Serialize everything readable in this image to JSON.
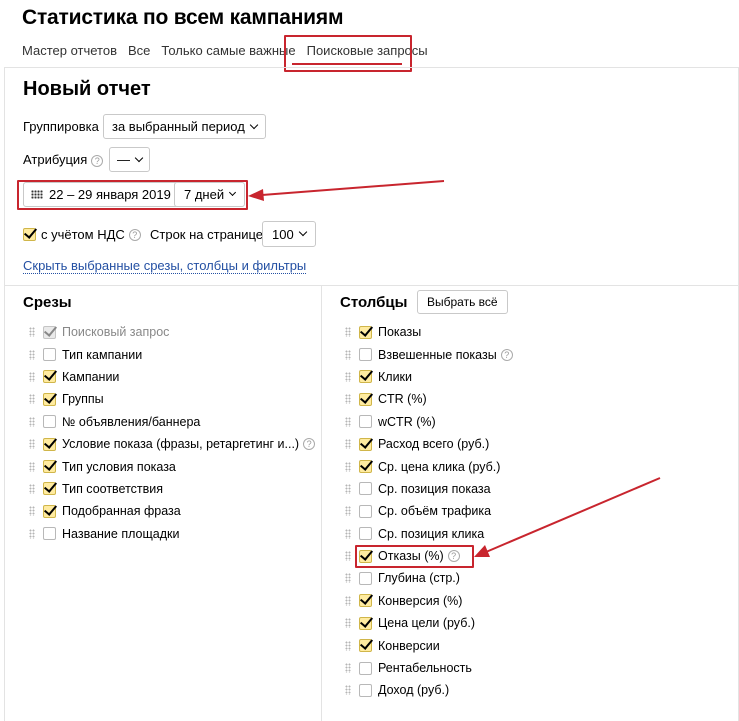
{
  "header": {
    "title": "Статистика по всем кампаниям"
  },
  "tabs": [
    {
      "label": "Мастер отчетов"
    },
    {
      "label": "Все"
    },
    {
      "label": "Только самые важные"
    },
    {
      "label": "Поисковые запросы"
    }
  ],
  "report": {
    "title": "Новый отчет",
    "grouping_label": "Группировка",
    "grouping_value": "за выбранный период",
    "attribution_label": "Атрибуция",
    "attribution_value": "—",
    "date_range": "22 – 29 января 2019",
    "period": "7 дней",
    "vat_label": "с учётом НДС",
    "rows_label": "Строк на странице",
    "rows_value": "100",
    "hide_link": "Скрыть выбранные срезы, столбцы и фильтры"
  },
  "slices": {
    "title": "Срезы",
    "items": [
      {
        "label": "Поисковый запрос",
        "checked": true,
        "disabled": true
      },
      {
        "label": "Тип кампании",
        "checked": false
      },
      {
        "label": "Кампании",
        "checked": true
      },
      {
        "label": "Группы",
        "checked": true
      },
      {
        "label": "№ объявления/баннера",
        "checked": false
      },
      {
        "label": "Условие показа (фразы, ретаргетинг и...)",
        "checked": true,
        "help": true
      },
      {
        "label": "Тип условия показа",
        "checked": true
      },
      {
        "label": "Тип соответствия",
        "checked": true
      },
      {
        "label": "Подобранная фраза",
        "checked": true
      },
      {
        "label": "Название площадки",
        "checked": false
      }
    ]
  },
  "columns": {
    "title": "Столбцы",
    "select_all": "Выбрать всё",
    "items": [
      {
        "label": "Показы",
        "checked": true
      },
      {
        "label": "Взвешенные показы",
        "checked": false,
        "help": true
      },
      {
        "label": "Клики",
        "checked": true
      },
      {
        "label": "CTR (%)",
        "checked": true
      },
      {
        "label": "wCTR (%)",
        "checked": false
      },
      {
        "label": "Расход всего (руб.)",
        "checked": true
      },
      {
        "label": "Ср. цена клика (руб.)",
        "checked": true
      },
      {
        "label": "Ср. позиция показа",
        "checked": false
      },
      {
        "label": "Ср. объём трафика",
        "checked": false
      },
      {
        "label": "Ср. позиция клика",
        "checked": false
      },
      {
        "label": "Отказы (%)",
        "checked": true,
        "help": true
      },
      {
        "label": "Глубина (стр.)",
        "checked": false
      },
      {
        "label": "Конверсия (%)",
        "checked": true
      },
      {
        "label": "Цена цели (руб.)",
        "checked": true
      },
      {
        "label": "Конверсии",
        "checked": true
      },
      {
        "label": "Рентабельность",
        "checked": false
      },
      {
        "label": "Доход (руб.)",
        "checked": false
      }
    ]
  },
  "colors": {
    "accent": "#c8252e",
    "link": "#2450a3",
    "checkbox": "#ffeba0"
  }
}
